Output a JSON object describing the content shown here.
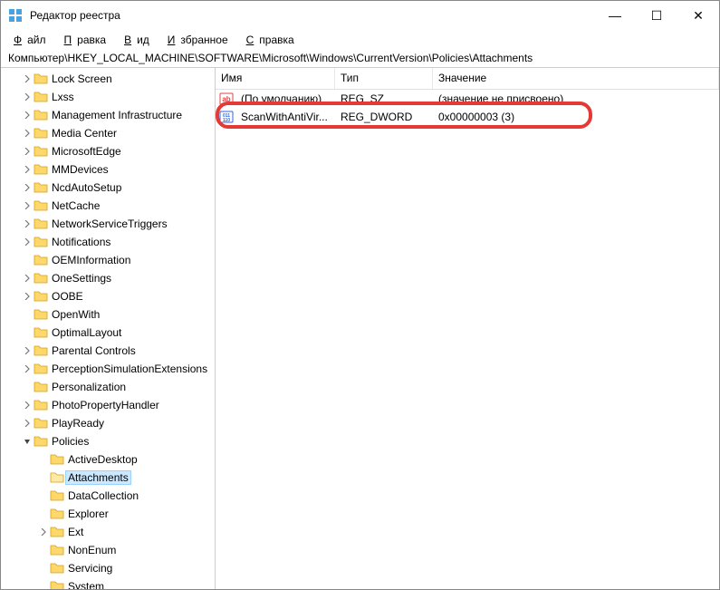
{
  "window": {
    "title": "Редактор реестра",
    "minimize": "—",
    "maximize": "☐",
    "close": "✕"
  },
  "menu": {
    "file": "Файл",
    "edit": "Правка",
    "view": "Вид",
    "favorites": "Избранное",
    "help": "Справка"
  },
  "path": "Компьютер\\HKEY_LOCAL_MACHINE\\SOFTWARE\\Microsoft\\Windows\\CurrentVersion\\Policies\\Attachments",
  "columns": {
    "name": "Имя",
    "type": "Тип",
    "value": "Значение"
  },
  "tree": [
    {
      "label": "Lock Screen",
      "indent": 1,
      "chev": "r"
    },
    {
      "label": "Lxss",
      "indent": 1,
      "chev": "r"
    },
    {
      "label": "Management Infrastructure",
      "indent": 1,
      "chev": "r"
    },
    {
      "label": "Media Center",
      "indent": 1,
      "chev": "r"
    },
    {
      "label": "MicrosoftEdge",
      "indent": 1,
      "chev": "r"
    },
    {
      "label": "MMDevices",
      "indent": 1,
      "chev": "r"
    },
    {
      "label": "NcdAutoSetup",
      "indent": 1,
      "chev": "r"
    },
    {
      "label": "NetCache",
      "indent": 1,
      "chev": "r"
    },
    {
      "label": "NetworkServiceTriggers",
      "indent": 1,
      "chev": "r"
    },
    {
      "label": "Notifications",
      "indent": 1,
      "chev": "r"
    },
    {
      "label": "OEMInformation",
      "indent": 1,
      "chev": ""
    },
    {
      "label": "OneSettings",
      "indent": 1,
      "chev": "r"
    },
    {
      "label": "OOBE",
      "indent": 1,
      "chev": "r"
    },
    {
      "label": "OpenWith",
      "indent": 1,
      "chev": ""
    },
    {
      "label": "OptimalLayout",
      "indent": 1,
      "chev": ""
    },
    {
      "label": "Parental Controls",
      "indent": 1,
      "chev": "r"
    },
    {
      "label": "PerceptionSimulationExtensions",
      "indent": 1,
      "chev": "r"
    },
    {
      "label": "Personalization",
      "indent": 1,
      "chev": ""
    },
    {
      "label": "PhotoPropertyHandler",
      "indent": 1,
      "chev": "r"
    },
    {
      "label": "PlayReady",
      "indent": 1,
      "chev": "r"
    },
    {
      "label": "Policies",
      "indent": 1,
      "chev": "d"
    },
    {
      "label": "ActiveDesktop",
      "indent": 2,
      "chev": ""
    },
    {
      "label": "Attachments",
      "indent": 2,
      "chev": "",
      "selected": true
    },
    {
      "label": "DataCollection",
      "indent": 2,
      "chev": ""
    },
    {
      "label": "Explorer",
      "indent": 2,
      "chev": ""
    },
    {
      "label": "Ext",
      "indent": 2,
      "chev": "r"
    },
    {
      "label": "NonEnum",
      "indent": 2,
      "chev": ""
    },
    {
      "label": "Servicing",
      "indent": 2,
      "chev": ""
    },
    {
      "label": "System",
      "indent": 2,
      "chev": ""
    }
  ],
  "rows": [
    {
      "icon": "str",
      "name": "(По умолчанию)",
      "type": "REG_SZ",
      "value": "(значение не присвоено)"
    },
    {
      "icon": "bin",
      "name": "ScanWithAntiVir...",
      "type": "REG_DWORD",
      "value": "0x00000003 (3)"
    }
  ]
}
